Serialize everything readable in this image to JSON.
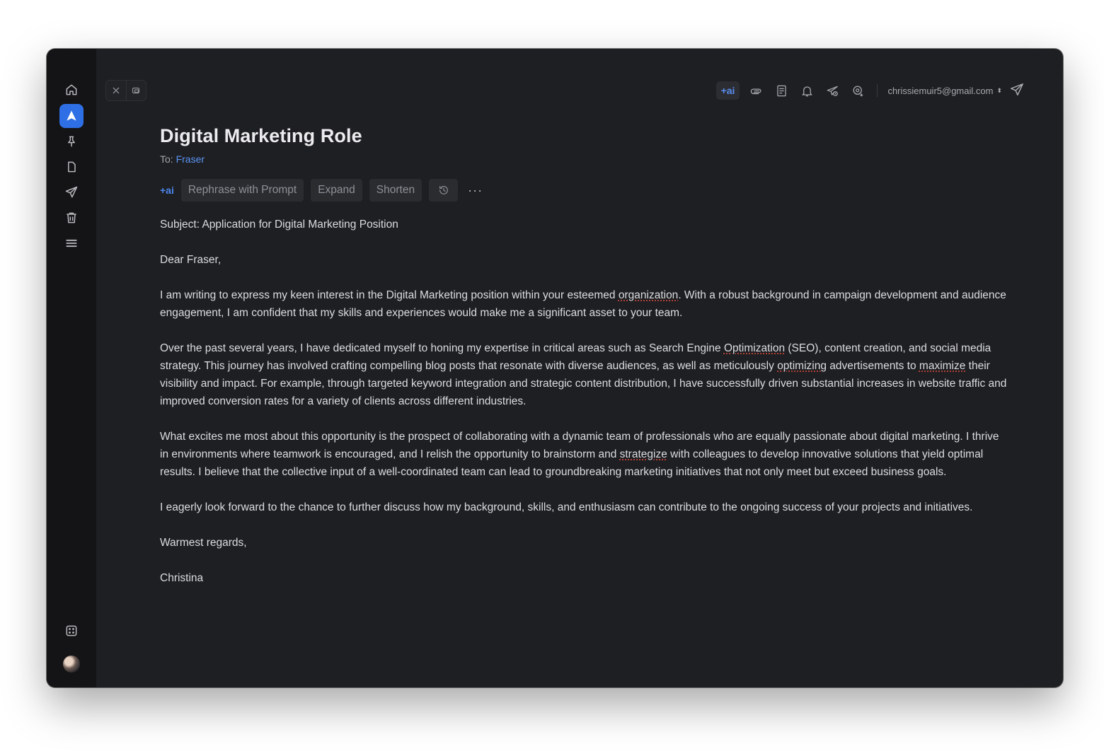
{
  "window": {
    "traffic_lights": [
      "close",
      "minimize",
      "zoom"
    ]
  },
  "sidebar": {
    "items": [
      {
        "name": "home",
        "icon": "home-icon"
      },
      {
        "name": "compose",
        "icon": "compose-logo-icon",
        "active": true
      },
      {
        "name": "pinned",
        "icon": "pin-icon"
      },
      {
        "name": "drafts",
        "icon": "draft-icon"
      },
      {
        "name": "sent",
        "icon": "send-icon"
      },
      {
        "name": "trash",
        "icon": "trash-icon"
      },
      {
        "name": "menu",
        "icon": "menu-icon"
      }
    ],
    "bottom": [
      {
        "name": "apps",
        "icon": "apps-icon"
      },
      {
        "name": "avatar",
        "icon": "avatar"
      }
    ]
  },
  "toolbar": {
    "ai_label": "+ai",
    "icons": [
      "attachment-icon",
      "template-icon",
      "reminder-icon",
      "send-later-icon",
      "add-recipient-icon"
    ],
    "account": "chrissiemuir5@gmail.com",
    "account_chevron": "⬍"
  },
  "email": {
    "title": "Digital Marketing Role",
    "to_label": "To:",
    "to_name": "Fraser",
    "ai_tools": {
      "tag": "+ai",
      "rephrase": "Rephrase with Prompt",
      "expand": "Expand",
      "shorten": "Shorten",
      "more": "···"
    },
    "subject": "Subject: Application for Digital Marketing Position",
    "greeting": "Dear Fraser,",
    "p1_a": "I am writing to express my keen interest in the Digital Marketing position within your esteemed ",
    "p1_b": "organization",
    "p1_c": ". With a robust background in campaign development and audience engagement, I am confident that my skills and experiences would make me a significant asset to your team.",
    "p2_a": "Over the past several years, I have dedicated myself to honing my expertise in critical areas such as Search Engine ",
    "p2_b": "Optimization",
    "p2_c": " (SEO), content creation, and social media strategy. This journey has involved crafting compelling blog posts that resonate with diverse audiences, as well as meticulously ",
    "p2_d": "optimizing",
    "p2_e": " advertisements to ",
    "p2_f": "maximize",
    "p2_g": " their visibility and impact. For example, through targeted keyword integration and strategic content distribution, I have successfully driven substantial increases in website traffic and improved conversion rates for a variety of clients across different industries.",
    "p3_a": "What excites me most about this opportunity is the prospect of collaborating with a dynamic team of professionals who are equally passionate about digital marketing. I thrive in environments where teamwork is encouraged, and I relish the opportunity to brainstorm and ",
    "p3_b": "strategize",
    "p3_c": " with colleagues to develop innovative solutions that yield optimal results. I believe that the collective input of a well-coordinated team can lead to groundbreaking marketing initiatives that not only meet but exceed business goals.",
    "p4": "I eagerly look forward to the chance to further discuss how my background, skills, and enthusiasm can contribute to the ongoing success of your projects and initiatives.",
    "closing": "Warmest regards,",
    "signature": "Christina"
  },
  "colors": {
    "accent": "#2f6fe6",
    "link": "#5b94f5",
    "spellcheck": "#e04a3f",
    "background": "#1e1f22"
  }
}
